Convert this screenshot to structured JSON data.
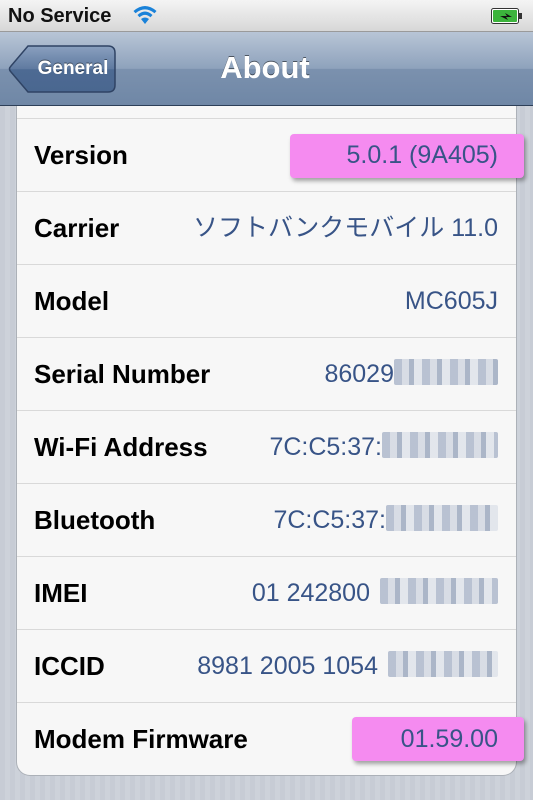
{
  "status_bar": {
    "carrier": "No Service",
    "wifi_icon": "wifi-icon",
    "battery_icon": "battery-charging-icon",
    "battery_color": "#3cb43c"
  },
  "nav": {
    "back_label": "General",
    "title": "About"
  },
  "rows": [
    {
      "label": "Version",
      "value": "5.0.1 (9A405)",
      "highlight": true
    },
    {
      "label": "Carrier",
      "value": "ソフトバンクモバイル 11.0"
    },
    {
      "label": "Model",
      "value": "MC605J"
    },
    {
      "label": "Serial Number",
      "value": "86029",
      "redacted": true
    },
    {
      "label": "Wi-Fi Address",
      "value": "7C:C5:37:",
      "redacted": true
    },
    {
      "label": "Bluetooth",
      "value": "7C:C5:37:",
      "redacted": true
    },
    {
      "label": "IMEI",
      "value": "01 242800",
      "redacted": true
    },
    {
      "label": "ICCID",
      "value": "8981 2005 1054",
      "redacted": true
    },
    {
      "label": "Modem Firmware",
      "value": "01.59.00",
      "highlight": true
    }
  ],
  "colors": {
    "highlight": "#f58bf0",
    "value_text": "#385487"
  }
}
